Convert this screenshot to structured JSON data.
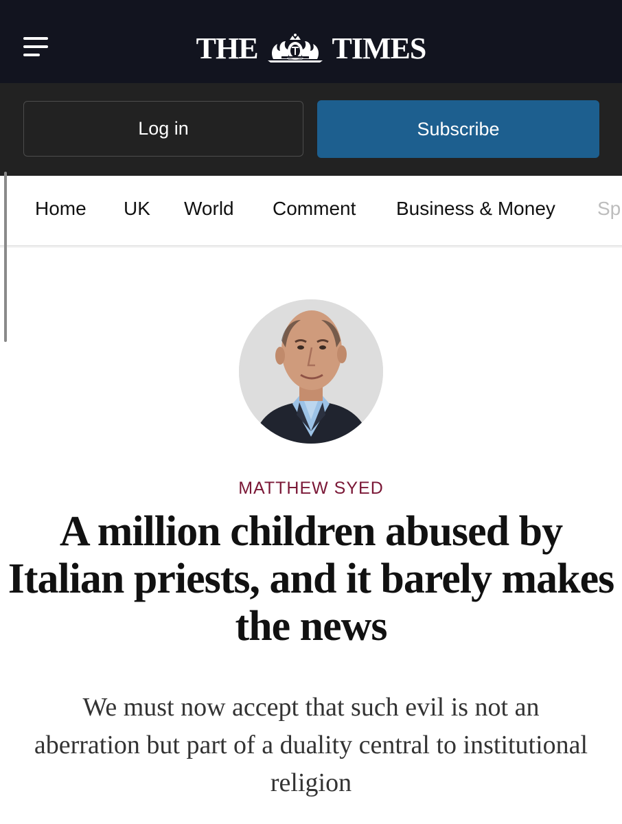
{
  "header": {
    "logo_left": "THE",
    "logo_right": "TIMES",
    "menu_icon": "hamburger-menu-icon",
    "crest_icon": "royal-coat-of-arms-icon"
  },
  "auth": {
    "login_label": "Log in",
    "subscribe_label": "Subscribe"
  },
  "nav": {
    "items": [
      "Home",
      "UK",
      "World",
      "Comment",
      "Business & Money",
      "Sp"
    ]
  },
  "article": {
    "author": "MATTHEW SYED",
    "headline": "A million children abused by Italian priests, and it barely makes the news",
    "standfirst": "We must now accept that such evil is not an aberration but part of a duality central to institutional religion"
  },
  "colors": {
    "header_bg": "#12141f",
    "auth_bg": "#222222",
    "subscribe_bg": "#1d5f8f",
    "author_color": "#7a1736"
  }
}
